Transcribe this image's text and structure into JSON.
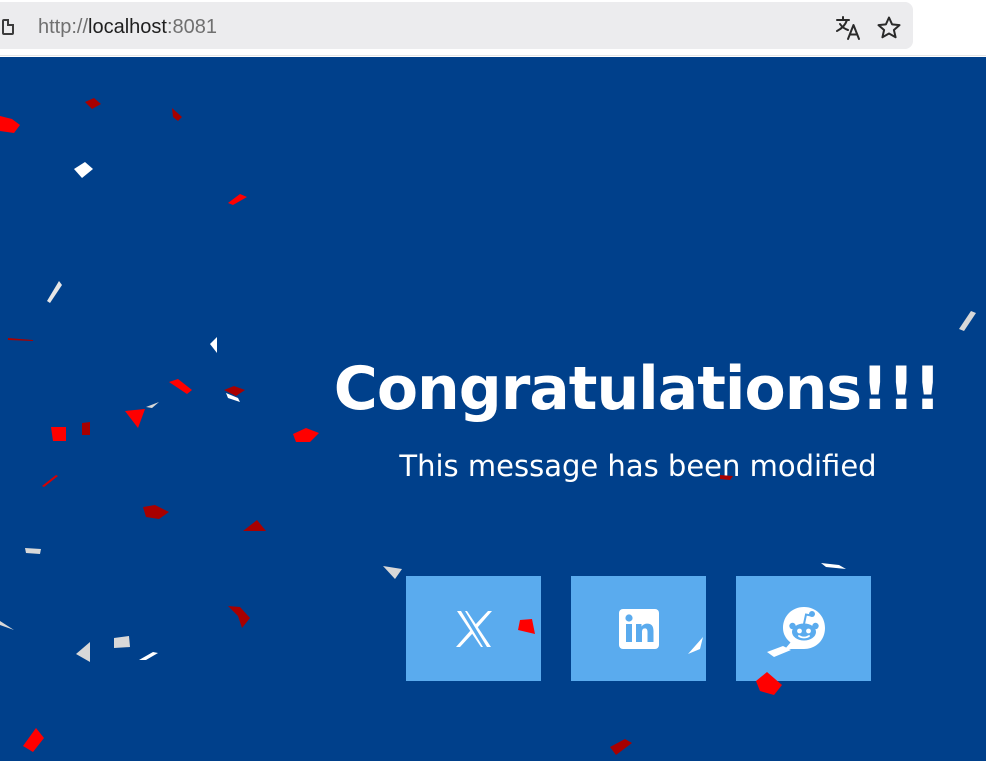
{
  "browser": {
    "url_scheme": "http://",
    "url_host": "localhost",
    "url_port": ":8081",
    "icons": [
      "page-icon",
      "translate-icon",
      "star-icon"
    ]
  },
  "page": {
    "background_color": "#00408b",
    "headline": "Congratulations!!!",
    "message": "This message has been modified",
    "share_buttons": [
      {
        "name": "x",
        "icon": "x-logo-icon",
        "color": "#5aabee"
      },
      {
        "name": "linkedin",
        "icon": "linkedin-logo-icon",
        "color": "#5aabee"
      },
      {
        "name": "reddit",
        "icon": "reddit-logo-icon",
        "color": "#5aabee"
      }
    ],
    "confetti_colors": [
      "#ff0000",
      "#a80000",
      "#ffffff",
      "#d8d8d8"
    ]
  }
}
